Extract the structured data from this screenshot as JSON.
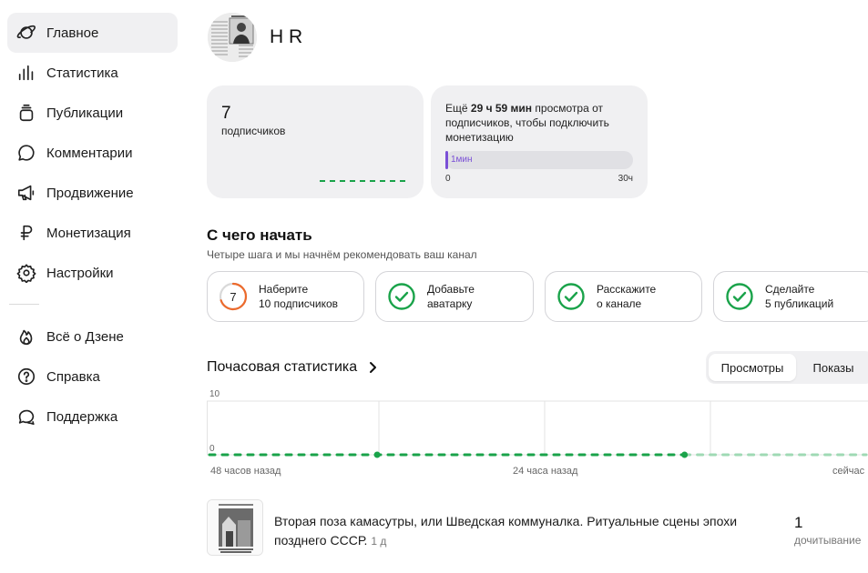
{
  "sidebar": {
    "items": [
      {
        "label": "Главное",
        "icon": "planet-icon",
        "active": true
      },
      {
        "label": "Статистика",
        "icon": "bar-chart-icon"
      },
      {
        "label": "Публикации",
        "icon": "stack-icon"
      },
      {
        "label": "Комментарии",
        "icon": "comment-icon"
      },
      {
        "label": "Продвижение",
        "icon": "megaphone-icon"
      },
      {
        "label": "Монетизация",
        "icon": "ruble-icon"
      },
      {
        "label": "Настройки",
        "icon": "gear-icon"
      }
    ],
    "secondary": [
      {
        "label": "Всё о Дзене",
        "icon": "flame-icon"
      },
      {
        "label": "Справка",
        "icon": "question-icon"
      },
      {
        "label": "Поддержка",
        "icon": "chat-icon"
      }
    ]
  },
  "header": {
    "channel_name": "H R"
  },
  "subscribers_card": {
    "count": "7",
    "label": "подписчиков"
  },
  "monetization_card": {
    "text_before": "Ещё ",
    "highlight": "29 ч 59 мин",
    "text_after": " просмотра от подписчиков, чтобы подключить монетизацию",
    "progress_label": "1мин",
    "progress_fraction": 0.0006,
    "min_label": "0",
    "max_label": "30ч"
  },
  "getting_started": {
    "title": "С чего начать",
    "subtitle": "Четыре шага и мы начнём рекомендовать ваш канал",
    "steps": [
      {
        "line1": "Наберите",
        "line2": "10 подписчиков",
        "type": "progress",
        "value": "7",
        "progress": 0.7
      },
      {
        "line1": "Добавьте",
        "line2": "аватарку",
        "type": "done"
      },
      {
        "line1": "Расскажите",
        "line2": "о канале",
        "type": "done"
      },
      {
        "line1": "Сделайте",
        "line2": "5 публикаций",
        "type": "done"
      }
    ]
  },
  "hourly": {
    "title": "Почасовая статистика",
    "tabs": [
      "Просмотры",
      "Показы"
    ],
    "active_tab": "Просмотры"
  },
  "chart_data": {
    "type": "line",
    "y_ticks": [
      "10",
      "0"
    ],
    "ylim": [
      0,
      10
    ],
    "x_labels": [
      "48 часов назад",
      "24 часа назад",
      "сейчас"
    ],
    "values": [
      0,
      0,
      0,
      0,
      0,
      0,
      0,
      0,
      0,
      0,
      0,
      0,
      0,
      0,
      0,
      0,
      0,
      0,
      0,
      0,
      0,
      0,
      0,
      0,
      0,
      0,
      0,
      0,
      0,
      0,
      0,
      0,
      0,
      0,
      0,
      0,
      0,
      0,
      0,
      0,
      0,
      0,
      0,
      0,
      0,
      0,
      0,
      0
    ],
    "highlight_points": [
      12,
      34
    ],
    "series_color": "#1aa34a",
    "future_color": "#9fd9b4"
  },
  "publication": {
    "title": "Вторая поза камасутры, или Шведская коммуналка. Ритуальные сцены эпохи позднего СССР.",
    "age": "1 д",
    "metric_value": "1",
    "metric_label": "дочитывание"
  }
}
